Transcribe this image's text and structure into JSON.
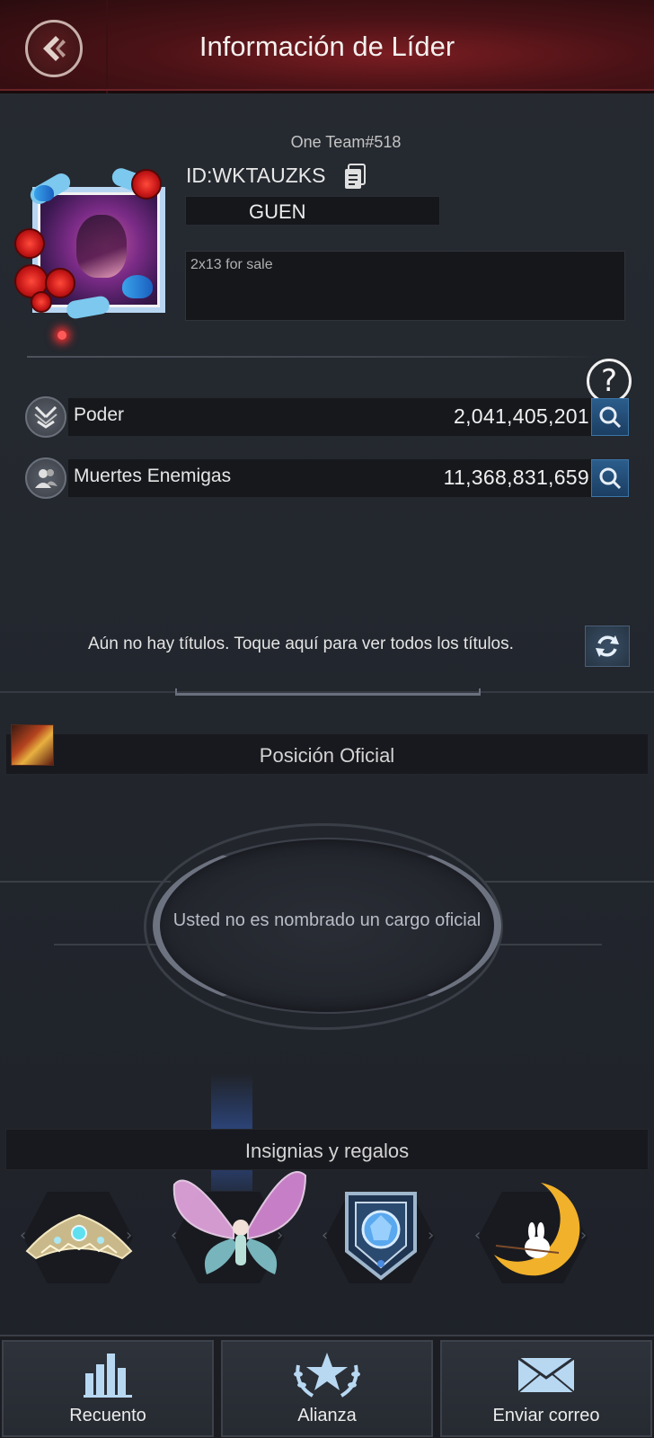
{
  "header": {
    "title": "Información de Líder"
  },
  "profile": {
    "server": "One Team#518",
    "player_id": "ID:WKTAUZKS",
    "name": "GUEN",
    "bio": "2x13 for sale"
  },
  "stats": [
    {
      "label": "Poder",
      "value": "2,041,405,201",
      "icon": "swords-icon"
    },
    {
      "label": "Muertes Enemigas",
      "value": "11,368,831,659",
      "icon": "users-icon"
    }
  ],
  "titles": {
    "message": "Aún no hay títulos. Toque aquí para ver todos los títulos."
  },
  "official": {
    "section_label": "Posición Oficial",
    "message": "Usted no es nombrado un cargo oficial"
  },
  "badges": {
    "section_label": "Insignias y regalos",
    "items": [
      "crown-tiara-icon",
      "fairy-butterfly-icon",
      "blue-gem-shield-icon",
      "moon-rabbit-icon"
    ]
  },
  "nav": {
    "items": [
      {
        "label": "Recuento",
        "icon": "bar-chart-icon"
      },
      {
        "label": "Alianza",
        "icon": "alliance-star-laurel-icon"
      },
      {
        "label": "Enviar correo",
        "icon": "envelope-icon"
      }
    ]
  },
  "colors": {
    "header_red": "#7a1d22",
    "accent_blue": "#2b5d8c",
    "background": "#23272e"
  }
}
